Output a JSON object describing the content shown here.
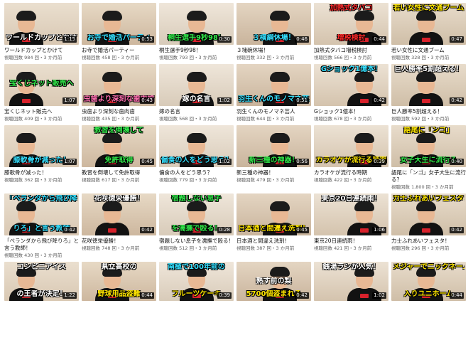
{
  "colors": {
    "wall_a": "#e9dccb",
    "wall_b": "#d8c7b2",
    "white": "#ffffff",
    "yellow": "#ffe600",
    "cyan": "#35e0ff",
    "red": "#ff2a2a",
    "green": "#31e84a",
    "pink": "#ff6fb0",
    "orange": "#ff8a1a"
  },
  "videos": [
    {
      "title": "ワールドカップとかけて",
      "views": "視聴回数 984 回・3 か月前",
      "duration": "1:15",
      "captions": [
        {
          "text": "ワールドカップとかけて",
          "pos": "bot",
          "color": "#ffffff"
        }
      ]
    },
    {
      "title": "お寺で婚活パーティー",
      "views": "視聴回数 458 回・3 か月前",
      "duration": "0:53",
      "captions": [
        {
          "text": "お寺で婚活パーティ",
          "pos": "bot",
          "color": "#35e0ff"
        }
      ]
    },
    {
      "title": "桐生選手9秒98！",
      "views": "視聴回数 793 回・3 か月前",
      "duration": "0:30",
      "captions": [
        {
          "text": "桐生選手9秒98！",
          "pos": "bot",
          "color": "#31e84a"
        }
      ]
    },
    {
      "title": "３塊碗休場！",
      "views": "視聴回数 332 回・3 か月前",
      "duration": "0:46",
      "captions": [
        {
          "text": "３横綱休場！",
          "pos": "bot",
          "color": "#35e0ff"
        }
      ]
    },
    {
      "title": "加熱式タバコ増税検討",
      "views": "視聴回数 566 回・3 か月前",
      "duration": "0:44",
      "captions": [
        {
          "text": "加熱式タバコ",
          "pos": "top",
          "color": "#ff2a2a"
        },
        {
          "text": "増税検討",
          "pos": "bot",
          "color": "#ff2a2a"
        }
      ]
    },
    {
      "title": "若い女性に文通ブーム",
      "views": "視聴回数 328 回・3 か月前",
      "duration": "0:47",
      "captions": [
        {
          "text": "若い女性に文通ブーム",
          "pos": "top",
          "color": "#ffe600"
        }
      ]
    },
    {
      "title": "宝くじネット販売へ",
      "views": "視聴回数 409 回・3 か月前",
      "duration": "1:07",
      "captions": [
        {
          "text": "宝くじネット販売へ",
          "pos": "mid",
          "color": "#31e84a"
        }
      ]
    },
    {
      "title": "虫歯より深刻な歯肉歯",
      "views": "視聴回数 435 回・3 か月前",
      "duration": "0:43",
      "captions": [
        {
          "text": "虫歯より深刻な歯肉歯",
          "pos": "bot",
          "color": "#ff6fb0"
        }
      ]
    },
    {
      "title": "嫁の名言",
      "views": "視聴回数 568 回・3 か月前",
      "duration": "1:02",
      "captions": [
        {
          "text": "嫁の名言",
          "pos": "bot",
          "color": "#ffffff"
        }
      ]
    },
    {
      "title": "羽生くんのモノマネ芸人",
      "views": "視聴回数 644 回・3 か月前",
      "duration": "0:51",
      "captions": [
        {
          "text": "羽生くんのモノマネ芸人",
          "pos": "bot",
          "color": "#35e0ff"
        }
      ]
    },
    {
      "title": "Gショック1億本！",
      "views": "視聴回数 678 回・3 か月前",
      "duration": "0:42",
      "captions": [
        {
          "text": "Gショック1億本！",
          "pos": "top",
          "color": "#35e0ff"
        }
      ]
    },
    {
      "title": "巨人勝率5割超える！",
      "views": "視聴回数 592 回・3 か月前",
      "duration": "0:42",
      "captions": [
        {
          "text": "巨人勝率5割超える！",
          "pos": "top",
          "color": "#ffffff"
        }
      ]
    },
    {
      "title": "膝歌骨が減った！",
      "views": "視聴回数 362 回・3 か月前",
      "duration": "1:07",
      "captions": [
        {
          "text": "膝軟骨が減った！",
          "pos": "bot",
          "color": "#35e0ff"
        }
      ]
    },
    {
      "title": "教習を倒壊して免許取得",
      "views": "視聴回数 617 回・3 か月前",
      "duration": "0:45",
      "captions": [
        {
          "text": "教習を倒壊して",
          "pos": "top",
          "color": "#31e84a"
        },
        {
          "text": "免許取得",
          "pos": "bot",
          "color": "#31e84a"
        }
      ]
    },
    {
      "title": "偏食の人をどう思う？",
      "views": "視聴回数 779 回・3 か月前",
      "duration": "1:02",
      "captions": [
        {
          "text": "偏食の人をどう思う？",
          "pos": "bot",
          "color": "#35e0ff"
        }
      ]
    },
    {
      "title": "新三種の神器！",
      "views": "視聴回数 479 回・3 か月前",
      "duration": "0:56",
      "captions": [
        {
          "text": "新三種の神器！",
          "pos": "bot",
          "color": "#31e84a"
        }
      ]
    },
    {
      "title": "カラオケが流行る時期",
      "views": "視聴回数 422 回・3 か月前",
      "duration": "0:39",
      "captions": [
        {
          "text": "カラオケが流行る時期",
          "pos": "bot",
          "color": "#ffe600"
        }
      ]
    },
    {
      "title": "語尾に「ンゴ」女子大生に流行る？",
      "views": "視聴回数 1,800 回・3 か月前",
      "duration": "0:40",
      "captions": [
        {
          "text": "語尾に「ンゴ」",
          "pos": "top",
          "color": "#ffe600"
        },
        {
          "text": "女子大生に流行る",
          "pos": "bot",
          "color": "#31e84a"
        }
      ]
    },
    {
      "title": "「ベランダから飛び降りろ」と言う教師！",
      "views": "視聴回数 430 回・3 か月前",
      "duration": "0:42",
      "captions": [
        {
          "text": "「ベランダから飛び降",
          "pos": "top",
          "color": "#35e0ff"
        },
        {
          "text": "りろ」と言う教師",
          "pos": "bot",
          "color": "#35e0ff"
        }
      ]
    },
    {
      "title": "花咲徳栄優勝！",
      "views": "視聴回数 748 回・3 か月前",
      "duration": "0:42",
      "captions": [
        {
          "text": "花咲徳栄優勝！",
          "pos": "top",
          "color": "#ffffff"
        }
      ]
    },
    {
      "title": "宿題しない息子を濡撫で殴る！",
      "views": "視聴回数 512 回・3 か月前",
      "duration": "0:28",
      "captions": [
        {
          "text": "宿題しない息子",
          "pos": "top",
          "color": "#31e84a"
        },
        {
          "text": "を濡撫で殴る！",
          "pos": "bot",
          "color": "#31e84a"
        }
      ]
    },
    {
      "title": "日本酒と間違え洗剤！",
      "views": "視聴回数 387 回・3 か月前",
      "duration": "0:45",
      "captions": [
        {
          "text": "日本酒と間違え洗剤！",
          "pos": "bot",
          "color": "#ffe600"
        }
      ]
    },
    {
      "title": "東京20日連続雨！",
      "views": "視聴回数 421 回・3 か月前",
      "duration": "1:06",
      "captions": [
        {
          "text": "東京20日連続雨！",
          "pos": "top",
          "color": "#ffffff"
        }
      ]
    },
    {
      "title": "力士ふれあいフェスタ！",
      "views": "視聴回数 296 回・3 か月前",
      "duration": "0:42",
      "captions": [
        {
          "text": "力士ふれあいフェスタ！",
          "pos": "top",
          "color": "#ffe600"
        }
      ]
    },
    {
      "title": "",
      "views": "",
      "duration": "1:22",
      "captions": [
        {
          "text": "コンビニアイス",
          "pos": "top",
          "color": "#ffffff"
        },
        {
          "text": "の王者が決定！",
          "pos": "bot",
          "color": "#ffffff"
        }
      ]
    },
    {
      "title": "",
      "views": "",
      "duration": "0:44",
      "captions": [
        {
          "text": "県立高校の",
          "pos": "top",
          "color": "#ffffff"
        },
        {
          "text": "野球用品盗難",
          "pos": "bot",
          "color": "#ffe600"
        }
      ]
    },
    {
      "title": "",
      "views": "",
      "duration": "0:39",
      "captions": [
        {
          "text": "南極で100年前の",
          "pos": "top",
          "color": "#35e0ff"
        },
        {
          "text": "フルーツケーキ",
          "pos": "bot",
          "color": "#ffe600"
        }
      ]
    },
    {
      "title": "",
      "views": "",
      "duration": "0:42",
      "captions": [
        {
          "text": "熟す前の梨",
          "pos": "mid",
          "color": "#ffffff"
        },
        {
          "text": "5700個盗まれる",
          "pos": "bot",
          "color": "#ffe600"
        }
      ]
    },
    {
      "title": "",
      "views": "",
      "duration": "1:02",
      "captions": [
        {
          "text": "銭湯ランが人気！",
          "pos": "top",
          "color": "#ffffff"
        }
      ]
    },
    {
      "title": "",
      "views": "",
      "duration": "0:44",
      "captions": [
        {
          "text": "メジャーでニックネーム",
          "pos": "top",
          "color": "#ffe600"
        },
        {
          "text": "入りユニホーム",
          "pos": "bot",
          "color": "#ffe600"
        }
      ]
    }
  ]
}
